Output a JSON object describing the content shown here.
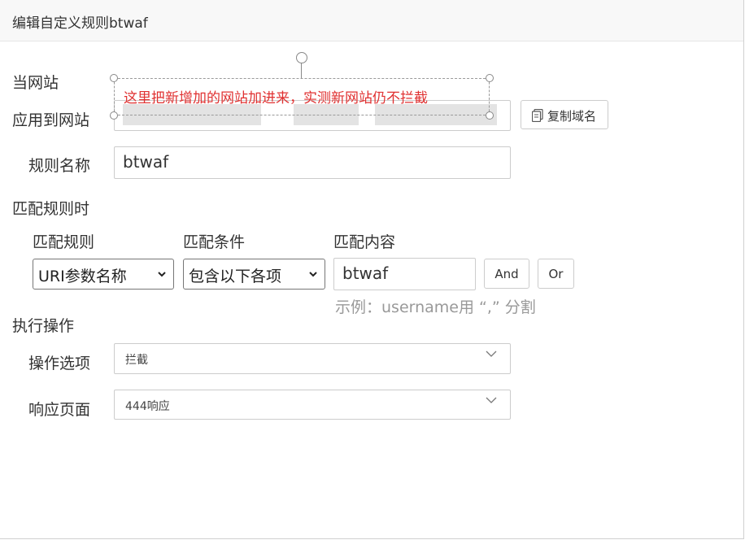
{
  "dialog": {
    "title": "编辑自定义规则btwaf"
  },
  "site_section": {
    "label": "当网站",
    "apply_to_label": "应用到网站",
    "copy_domain_label": "复制域名"
  },
  "rule_name": {
    "label": "规则名称",
    "value": "btwaf"
  },
  "match_section": {
    "label": "匹配规则时",
    "col_rule": "匹配规则",
    "col_condition": "匹配条件",
    "col_content": "匹配内容",
    "rule_value": "URI参数名称",
    "condition_value": "包含以下各项",
    "content_value": "btwaf",
    "and_label": "And",
    "or_label": "Or",
    "hint": "示例：username用 “,” 分割"
  },
  "action_section": {
    "label": "执行操作",
    "option_label": "操作选项",
    "option_value": "拦截",
    "response_label": "响应页面",
    "response_value": "444响应"
  },
  "annotation": {
    "text": "这里把新增加的网站加进来，实测新网站仍不拦截"
  },
  "colors": {
    "annotation_red": "#e03131"
  }
}
